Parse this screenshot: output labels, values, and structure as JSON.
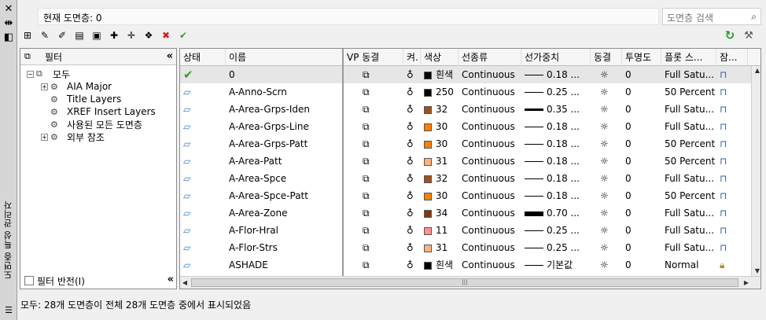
{
  "window": {
    "title": "도면층 특성 관리자",
    "close_glyph": "✕",
    "pin_glyph": "⇹",
    "props_glyph": "◧"
  },
  "current_layer": "현재 도면층: 0",
  "search": {
    "placeholder": "도면층 검색",
    "icon": "search-icon"
  },
  "toolbar": {
    "buttons": [
      {
        "name": "new-property-filter-button",
        "glyph": "⊞"
      },
      {
        "name": "new-group-filter-button",
        "glyph": "✎"
      },
      {
        "name": "layer-states-manager-button",
        "glyph": "✐"
      },
      {
        "name": "layer-states-button",
        "glyph": "▤"
      },
      {
        "name": "save-button",
        "glyph": "▣"
      },
      {
        "name": "new-layer-button",
        "glyph": "✚"
      },
      {
        "name": "new-layer-vp-frozen-button",
        "glyph": "✛"
      },
      {
        "name": "new-layer-all-vp-button",
        "glyph": "❖"
      },
      {
        "name": "delete-layer-button",
        "glyph": "✖",
        "color": "#d02020"
      },
      {
        "name": "set-current-button",
        "glyph": "✔",
        "color": "#2ea02e"
      }
    ],
    "refresh_glyph": "↻",
    "settings_glyph": "⚒"
  },
  "filters": {
    "header_label": "필터",
    "collapse_glyph": "«",
    "tree": [
      {
        "label": "모두",
        "expander": "−",
        "level": 0
      },
      {
        "label": "AIA Major",
        "expander": "+",
        "level": 1
      },
      {
        "label": "Title Layers",
        "expander": "",
        "level": 1
      },
      {
        "label": "XREF Insert Layers",
        "expander": "",
        "level": 1
      },
      {
        "label": "사용된 모든 도면층",
        "expander": "",
        "level": 1
      },
      {
        "label": "외부 참조",
        "expander": "+",
        "level": 1
      }
    ],
    "invert_label": "필터 반전(I)"
  },
  "table": {
    "columns": [
      "상태",
      "이름",
      "VP 동결",
      "켜.",
      "색상",
      "선종류",
      "선가중치",
      "동결",
      "투명도",
      "플롯 스...",
      "잠..."
    ],
    "rows": [
      {
        "status": "current",
        "name": "0",
        "color_name": "흰색",
        "color_hex": "#000000",
        "linetype": "Continuous",
        "lineweight": "0.18 ...",
        "lw_thickness": 1,
        "transparency": "0",
        "plot_style": "Full Satu...",
        "locked": false
      },
      {
        "status": "layer",
        "name": "A-Anno-Scrn",
        "color_name": "250",
        "color_hex": "#000000",
        "linetype": "Continuous",
        "lineweight": "0.25 ...",
        "lw_thickness": 1,
        "transparency": "0",
        "plot_style": "50 Percent",
        "locked": false
      },
      {
        "status": "layer",
        "name": "A-Area-Grps-Iden",
        "color_name": "32",
        "color_hex": "#a0501e",
        "linetype": "Continuous",
        "lineweight": "0.35 ...",
        "lw_thickness": 3,
        "transparency": "0",
        "plot_style": "Full Satu...",
        "locked": false
      },
      {
        "status": "layer",
        "name": "A-Area-Grps-Line",
        "color_name": "30",
        "color_hex": "#ff8000",
        "linetype": "Continuous",
        "lineweight": "0.18 ...",
        "lw_thickness": 1,
        "transparency": "0",
        "plot_style": "Full Satu...",
        "locked": false
      },
      {
        "status": "layer",
        "name": "A-Area-Grps-Patt",
        "color_name": "30",
        "color_hex": "#ff8000",
        "linetype": "Continuous",
        "lineweight": "0.18 ...",
        "lw_thickness": 1,
        "transparency": "0",
        "plot_style": "50 Percent",
        "locked": false
      },
      {
        "status": "layer",
        "name": "A-Area-Patt",
        "color_name": "31",
        "color_hex": "#ffb27a",
        "linetype": "Continuous",
        "lineweight": "0.18 ...",
        "lw_thickness": 1,
        "transparency": "0",
        "plot_style": "50 Percent",
        "locked": false
      },
      {
        "status": "layer",
        "name": "A-Area-Spce",
        "color_name": "32",
        "color_hex": "#a0501e",
        "linetype": "Continuous",
        "lineweight": "0.18 ...",
        "lw_thickness": 1,
        "transparency": "0",
        "plot_style": "Full Satu...",
        "locked": false
      },
      {
        "status": "layer",
        "name": "A-Area-Spce-Patt",
        "color_name": "30",
        "color_hex": "#ff8000",
        "linetype": "Continuous",
        "lineweight": "0.18 ...",
        "lw_thickness": 1,
        "transparency": "0",
        "plot_style": "50 Percent",
        "locked": false
      },
      {
        "status": "layer",
        "name": "A-Area-Zone",
        "color_name": "34",
        "color_hex": "#7a3a10",
        "linetype": "Continuous",
        "lineweight": "0.70 ...",
        "lw_thickness": 6,
        "transparency": "0",
        "plot_style": "Full Satu...",
        "locked": false
      },
      {
        "status": "layer",
        "name": "A-Flor-Hral",
        "color_name": "11",
        "color_hex": "#ff9090",
        "linetype": "Continuous",
        "lineweight": "0.25 ...",
        "lw_thickness": 1,
        "transparency": "0",
        "plot_style": "Full Satu...",
        "locked": false
      },
      {
        "status": "layer",
        "name": "A-Flor-Strs",
        "color_name": "31",
        "color_hex": "#ffb27a",
        "linetype": "Continuous",
        "lineweight": "0.25 ...",
        "lw_thickness": 1,
        "transparency": "0",
        "plot_style": "Full Satu...",
        "locked": false
      },
      {
        "status": "layer",
        "name": "ASHADE",
        "color_name": "흰색",
        "color_hex": "#000000",
        "linetype": "Continuous",
        "lineweight": "기본값",
        "lw_thickness": 1,
        "transparency": "0",
        "plot_style": "Normal",
        "locked": true
      }
    ]
  },
  "scroll_grip": "|||",
  "status_bar": "모두: 28개 도면층이 전체 28개 도면층 중에서 표시되었음"
}
